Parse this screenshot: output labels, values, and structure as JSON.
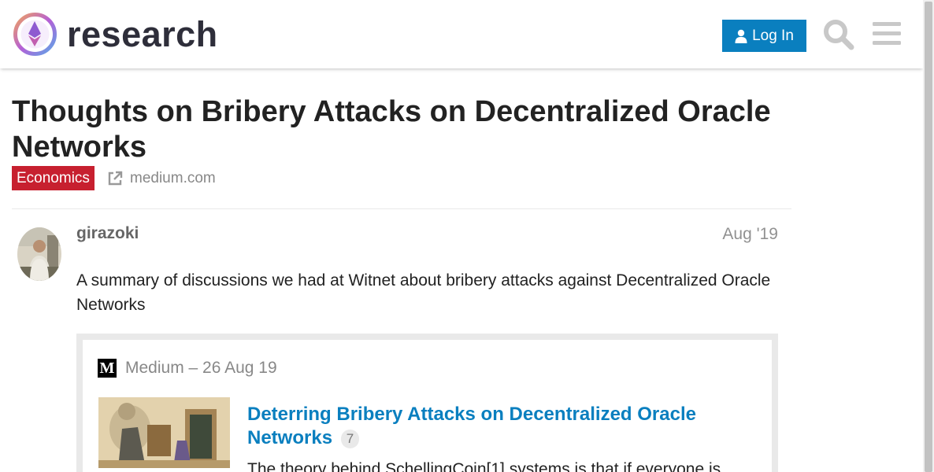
{
  "header": {
    "logo_text": "research",
    "login_label": "Log In"
  },
  "topic": {
    "title": "Thoughts on Bribery Attacks on Decentralized Oracle Networks",
    "category": "Economics",
    "external_link": "medium.com"
  },
  "post": {
    "username": "girazoki",
    "date": "Aug '19",
    "body": "A summary of discussions we had at Witnet about bribery attacks against Decentralized Oracle Networks",
    "onebox": {
      "source": "Medium – 26 Aug 19",
      "title": "Deterring Bribery Attacks on Decentralized Oracle Networks",
      "reply_count": "7",
      "excerpt": "The theory behind SchellingCoin[1] systems is that if everyone is"
    }
  },
  "colors": {
    "accent": "#0a7fbf",
    "category": "#c7202f"
  },
  "icons": [
    "user-icon",
    "search-icon",
    "hamburger-menu-icon",
    "external-link-icon",
    "medium-logo-icon"
  ]
}
